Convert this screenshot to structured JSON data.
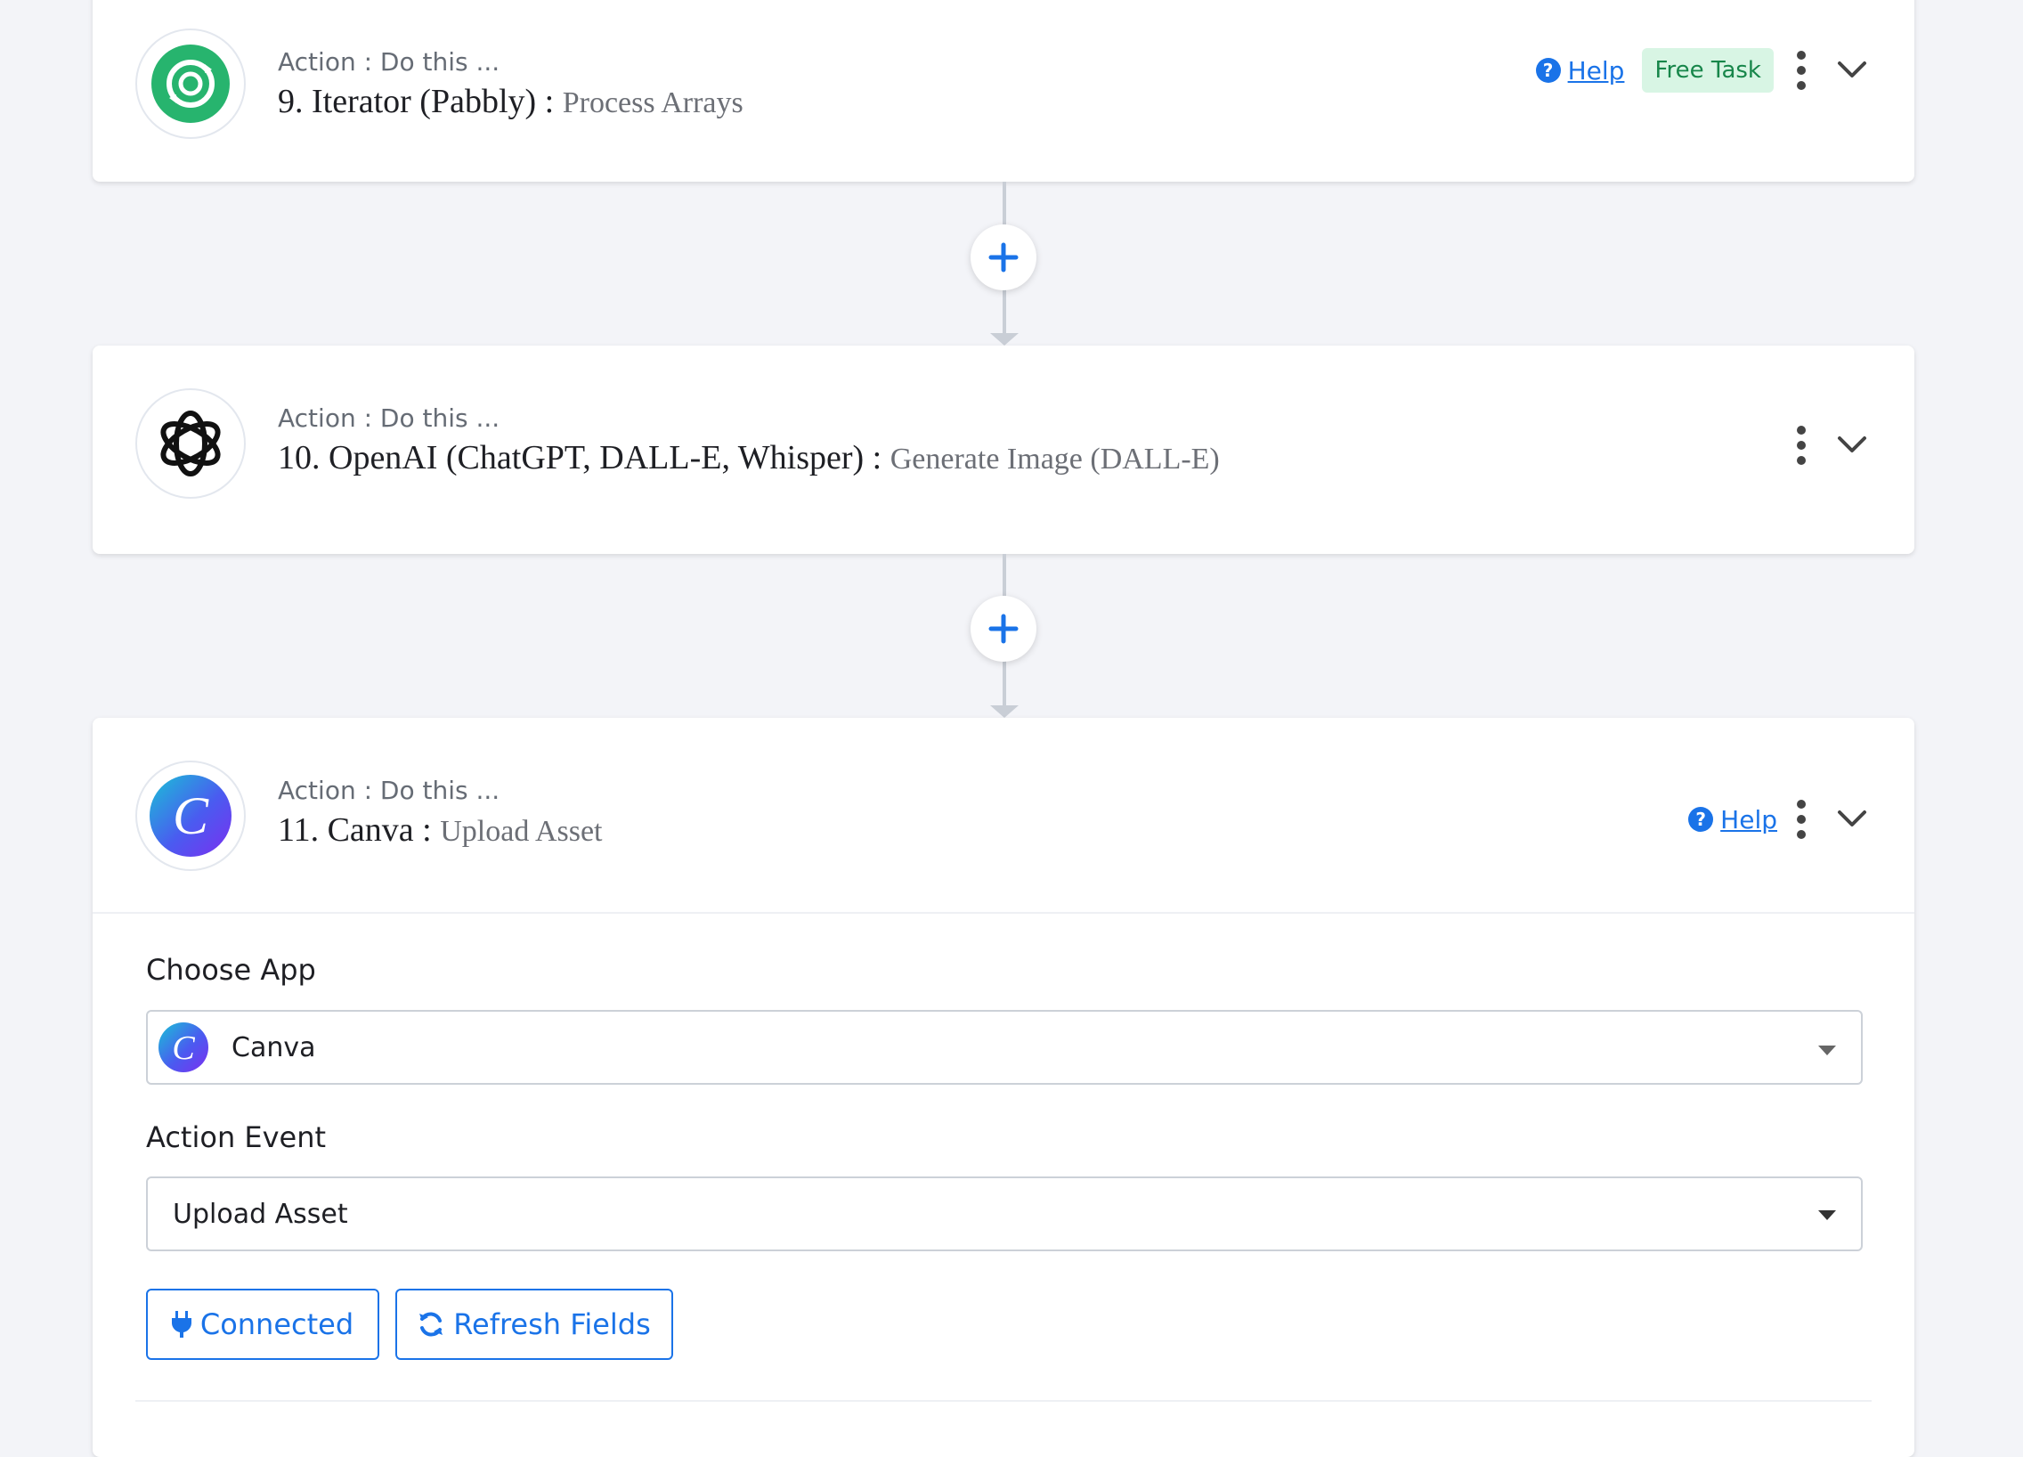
{
  "steps": [
    {
      "action_label": "Action : Do this ...",
      "title": "9. Iterator (Pabbly) : ",
      "subtitle": "Process Arrays",
      "help_label": "Help",
      "badge": "Free Task",
      "icon": "iterator-icon",
      "logo_color": "#27b46e"
    },
    {
      "action_label": "Action : Do this ...",
      "title": "10. OpenAI (ChatGPT, DALL-E, Whisper) : ",
      "subtitle": "Generate Image (DALL-E)",
      "icon": "openai-icon"
    },
    {
      "action_label": "Action : Do this ...",
      "title": "11. Canva : ",
      "subtitle": "Upload Asset",
      "help_label": "Help",
      "icon": "canva-icon"
    }
  ],
  "form": {
    "choose_app_label": "Choose App",
    "app_value": "Canva",
    "action_event_label": "Action Event",
    "event_value": "Upload Asset",
    "connected_label": "Connected",
    "refresh_label": "Refresh Fields"
  },
  "colors": {
    "accent": "#1a73e8",
    "badge_bg": "#d8f5e4",
    "badge_text": "#17864a",
    "background": "#f3f4f8"
  }
}
